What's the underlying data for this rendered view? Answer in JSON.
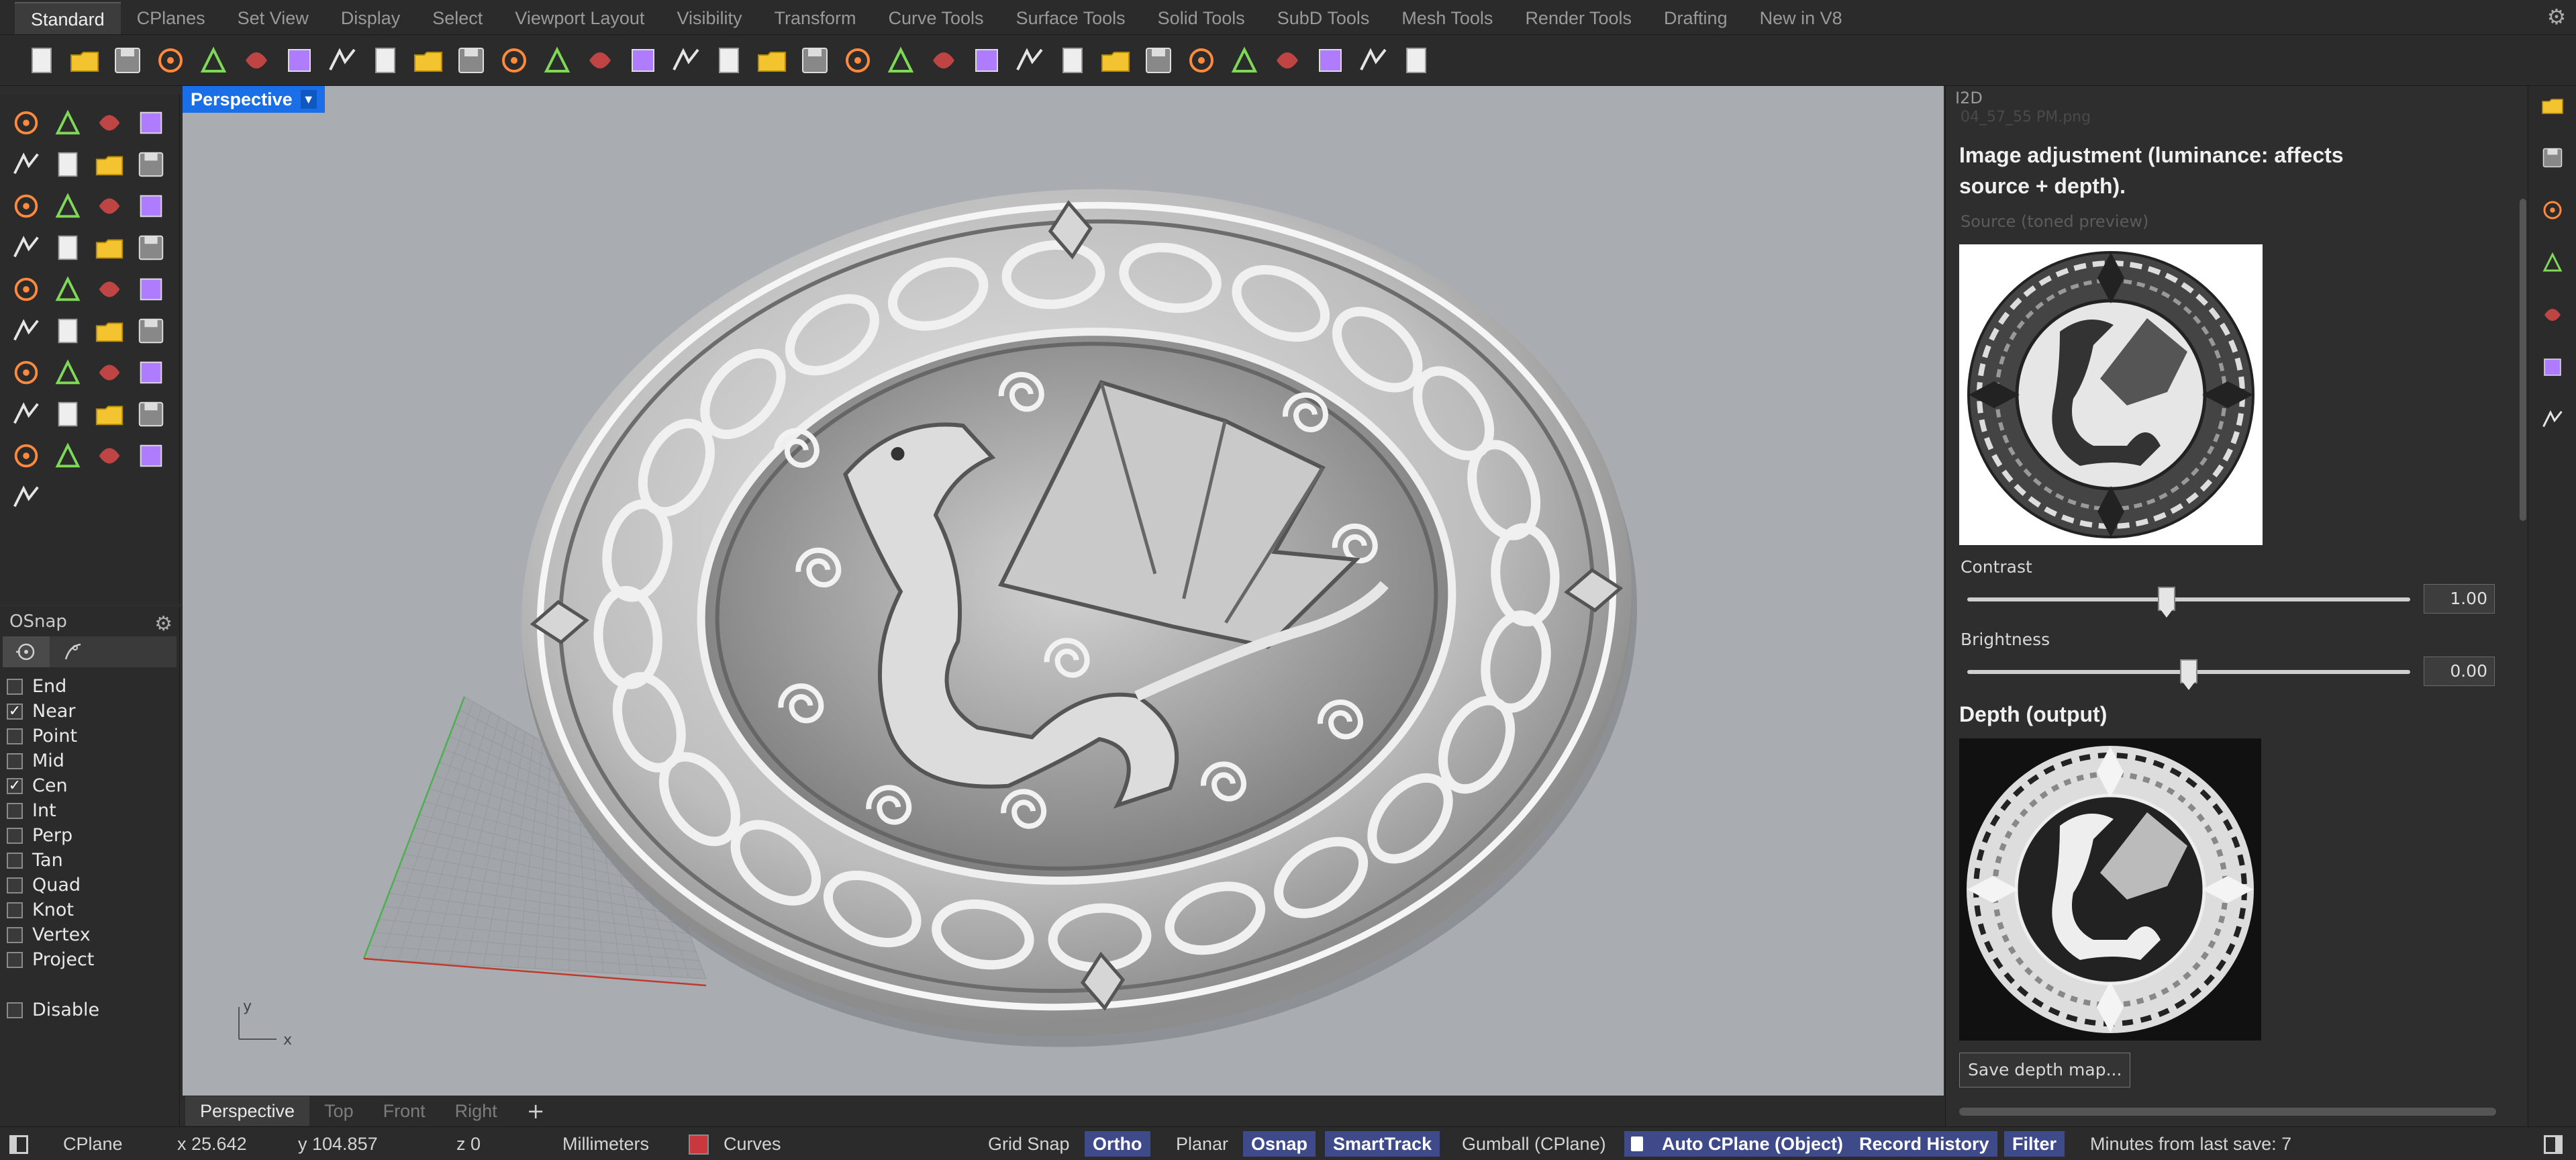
{
  "tabs": [
    "Standard",
    "CPlanes",
    "Set View",
    "Display",
    "Select",
    "Viewport Layout",
    "Visibility",
    "Transform",
    "Curve Tools",
    "Surface Tools",
    "Solid Tools",
    "SubD Tools",
    "Mesh Tools",
    "Render Tools",
    "Drafting",
    "New in V8"
  ],
  "active_tab": "Standard",
  "toolbar_icons": [
    "new-file",
    "open-folder",
    "save",
    "print",
    "template",
    "cut",
    "copy",
    "paste",
    "undo",
    "pan-hand",
    "rotate-view",
    "zoom-dynamic",
    "zoom-window",
    "zoom-extents",
    "zoom-selected",
    "rotate-3d",
    "four-viewports",
    "car-object",
    "cplane",
    "snap-target",
    "light-points",
    "bulb",
    "lock",
    "layers",
    "color-wheel",
    "ghosted",
    "wireframe-sphere",
    "render-sphere",
    "render-rays",
    "gear-options",
    "dimension",
    "globe",
    "help"
  ],
  "left_tool_icons": [
    "select-arrow",
    "point",
    "polyline",
    "curve",
    "circle",
    "ellipse",
    "arc-polygon",
    "rectangle",
    "polygon",
    "fillet-curve",
    "surface-patch",
    "surface-loft",
    "box-solid",
    "sphere-solid",
    "cylinder-solid",
    "mesh-plane",
    "explode",
    "gumball-arrow",
    "extend",
    "trim",
    "boolean",
    "group",
    "rebuild",
    "join-curve",
    "text",
    "scale",
    "array",
    "fillet-edge",
    "extrude",
    "dimension-tick",
    "mesh-grid",
    "analyze",
    "paint-bucket",
    "gumball-move",
    "checkmark",
    "shell",
    "highlighter"
  ],
  "viewport": {
    "label": "Perspective",
    "axis_y": "y",
    "axis_x": "x",
    "tabs": [
      "Perspective",
      "Top",
      "Front",
      "Right"
    ],
    "active_tab": "Perspective",
    "add_tab": "+"
  },
  "osnap": {
    "title": "OSnap",
    "items": [
      {
        "label": "End",
        "checked": false
      },
      {
        "label": "Near",
        "checked": true
      },
      {
        "label": "Point",
        "checked": false
      },
      {
        "label": "Mid",
        "checked": false
      },
      {
        "label": "Cen",
        "checked": true
      },
      {
        "label": "Int",
        "checked": false
      },
      {
        "label": "Perp",
        "checked": false
      },
      {
        "label": "Tan",
        "checked": false
      },
      {
        "label": "Quad",
        "checked": false
      },
      {
        "label": "Knot",
        "checked": false
      },
      {
        "label": "Vertex",
        "checked": false
      },
      {
        "label": "Project",
        "checked": false
      }
    ],
    "disable": {
      "label": "Disable",
      "checked": false
    }
  },
  "panel": {
    "title": "I2D",
    "filename": "04_57_55 PM.png",
    "heading": "Image adjustment (luminance: affects source + depth).",
    "source_label": "Source (toned preview)",
    "contrast_label": "Contrast",
    "contrast_value": "1.00",
    "contrast_fraction": 0.45,
    "brightness_label": "Brightness",
    "brightness_value": "0.00",
    "brightness_fraction": 0.5,
    "depth_heading": "Depth (output)",
    "save_button": "Save depth map..."
  },
  "strip_icons": [
    "settings-gear",
    "layers-stack",
    "color-wheel",
    "display-screen",
    "help-book",
    "brush",
    "panel-dock"
  ],
  "status": {
    "cplane": "CPlane",
    "x": "x 25.642",
    "y": "y 104.857",
    "z": "z 0",
    "units": "Millimeters",
    "layer": "Curves",
    "layer_color": "#c8383d",
    "grid_snap": "Grid Snap",
    "ortho": "Ortho",
    "planar": "Planar",
    "osnap": "Osnap",
    "smarttrack": "SmartTrack",
    "gumball": "Gumball (CPlane)",
    "autocplane": "Auto CPlane (Object)",
    "record_history": "Record History",
    "filter": "Filter",
    "save_info": "Minutes from last save: 7"
  },
  "colors": {
    "accent": "#1a6fe8",
    "toggle_on": "#3e4a8a",
    "viewport_bg": "#a9adb2"
  }
}
